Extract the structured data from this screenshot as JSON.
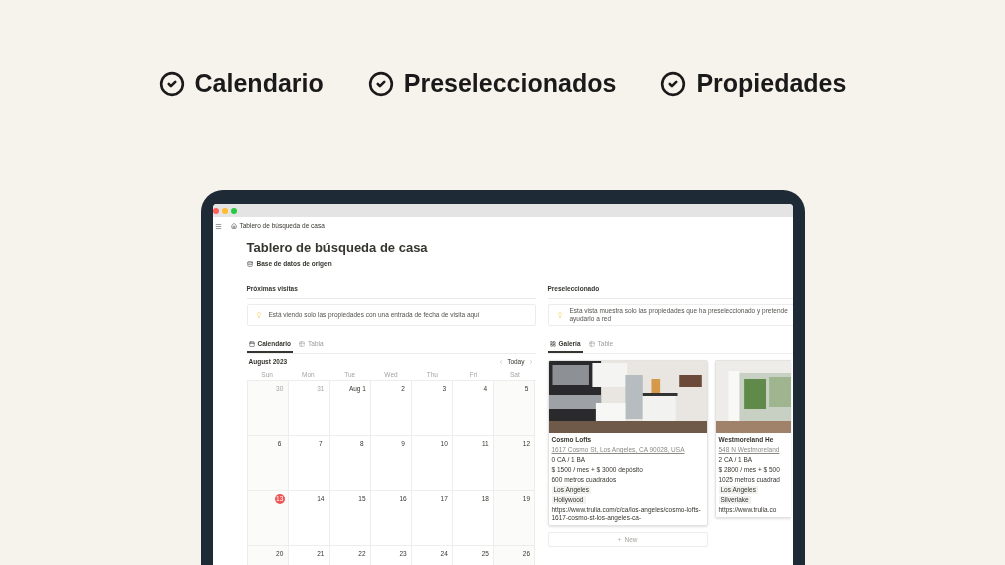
{
  "features": [
    {
      "label": "Calendario"
    },
    {
      "label": "Preseleccionados"
    },
    {
      "label": "Propiedades"
    }
  ],
  "breadcrumb": "Tablero de búsqueda de casa",
  "page": {
    "title": "Tablero de búsqueda de casa",
    "source_link": "Base de datos de origen"
  },
  "upcoming": {
    "heading": "Próximas visitas",
    "callout": "Está viendo solo las propiedades con una entrada de fecha de visita aquí",
    "tabs": [
      {
        "label": "Calendario",
        "kind": "calendar",
        "selected": true
      },
      {
        "label": "Tabla",
        "kind": "table",
        "selected": false
      }
    ],
    "calendar": {
      "month": "August 2023",
      "today_button": "Today",
      "weekdays": [
        "Sun",
        "Mon",
        "Tue",
        "Wed",
        "Thu",
        "Fri",
        "Sat"
      ],
      "weeks": [
        [
          {
            "label": "30",
            "outside": true,
            "today": false
          },
          {
            "label": "31",
            "outside": true,
            "today": false
          },
          {
            "label": "Aug 1",
            "outside": false,
            "today": false
          },
          {
            "label": "2",
            "outside": false,
            "today": false
          },
          {
            "label": "3",
            "outside": false,
            "today": false
          },
          {
            "label": "4",
            "outside": false,
            "today": false
          },
          {
            "label": "5",
            "outside": false,
            "today": false
          }
        ],
        [
          {
            "label": "6",
            "outside": false,
            "today": false
          },
          {
            "label": "7",
            "outside": false,
            "today": false
          },
          {
            "label": "8",
            "outside": false,
            "today": false
          },
          {
            "label": "9",
            "outside": false,
            "today": false
          },
          {
            "label": "10",
            "outside": false,
            "today": false
          },
          {
            "label": "11",
            "outside": false,
            "today": false
          },
          {
            "label": "12",
            "outside": false,
            "today": false
          }
        ],
        [
          {
            "label": "13",
            "outside": false,
            "today": true
          },
          {
            "label": "14",
            "outside": false,
            "today": false
          },
          {
            "label": "15",
            "outside": false,
            "today": false
          },
          {
            "label": "16",
            "outside": false,
            "today": false
          },
          {
            "label": "17",
            "outside": false,
            "today": false
          },
          {
            "label": "18",
            "outside": false,
            "today": false
          },
          {
            "label": "19",
            "outside": false,
            "today": false
          }
        ],
        [
          {
            "label": "20",
            "outside": false,
            "today": false
          },
          {
            "label": "21",
            "outside": false,
            "today": false
          },
          {
            "label": "22",
            "outside": false,
            "today": false
          },
          {
            "label": "23",
            "outside": false,
            "today": false
          },
          {
            "label": "24",
            "outside": false,
            "today": false
          },
          {
            "label": "25",
            "outside": false,
            "today": false
          },
          {
            "label": "26",
            "outside": false,
            "today": false
          }
        ]
      ]
    }
  },
  "shortlist": {
    "heading": "Preseleccionado",
    "callout": "Esta vista muestra solo las propiedades que ha preseleccionado y pretende ayudarlo a red",
    "tabs": [
      {
        "label": "Galería",
        "kind": "gallery",
        "selected": true
      },
      {
        "label": "Table",
        "kind": "table",
        "selected": false
      }
    ],
    "cards": [
      {
        "kind": "picture",
        "title": "Cosmo Lofts",
        "address": "1617 Cosmo St, Los Angeles, CA 90028, USA",
        "rooms": "0 CA / 1 BA",
        "price": "$ 1500 / mes + $ 3000 depósito",
        "size": "600 metros cuadrados",
        "tags": [
          "Los Angeles",
          "Hollywood"
        ],
        "url": "https://www.trulia.com/c/ca/los-angeles/cosmo-lofts-1617-cosmo-st-los-angeles-ca-"
      },
      {
        "kind": "picture",
        "title": "Westmoreland He",
        "address": "548 N Westmoreland",
        "rooms": "2 CA / 1 BA",
        "price": "$ 2800 / mes + $ 500",
        "size": "1025 metros cuadrad",
        "tags": [
          "Los Angeles",
          "Silverlake"
        ],
        "url": "https://www.trulia.co"
      }
    ],
    "new_button": "New"
  }
}
